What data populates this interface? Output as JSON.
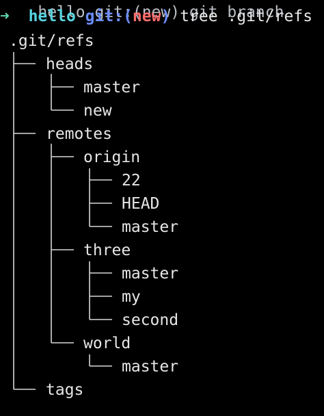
{
  "prompt": {
    "ghost_text": "hello git:(new) git branch",
    "arrow": "➜",
    "directory": "hello",
    "git_label": "git:(",
    "branch": "new",
    "git_close": ")",
    "command": "tree .git/refs"
  },
  "tree": {
    "root": ".git/refs",
    "nodes": [
      {
        "label": "heads",
        "depth": 1
      },
      {
        "label": "master",
        "depth": 2
      },
      {
        "label": "new",
        "depth": 2
      },
      {
        "label": "remotes",
        "depth": 1
      },
      {
        "label": "origin",
        "depth": 2
      },
      {
        "label": "22",
        "depth": 3
      },
      {
        "label": "HEAD",
        "depth": 3
      },
      {
        "label": "master",
        "depth": 3
      },
      {
        "label": "three",
        "depth": 2
      },
      {
        "label": "master",
        "depth": 3
      },
      {
        "label": "my",
        "depth": 3
      },
      {
        "label": "second",
        "depth": 3
      },
      {
        "label": "world",
        "depth": 2
      },
      {
        "label": "master",
        "depth": 3
      },
      {
        "label": "tags",
        "depth": 1
      }
    ]
  },
  "colors": {
    "background": "#000000",
    "text": "#e6e6e6",
    "arrow": "#5fd7af",
    "directory": "#56d4e0",
    "git": "#6c8cff",
    "branch": "#ff6b6b"
  }
}
